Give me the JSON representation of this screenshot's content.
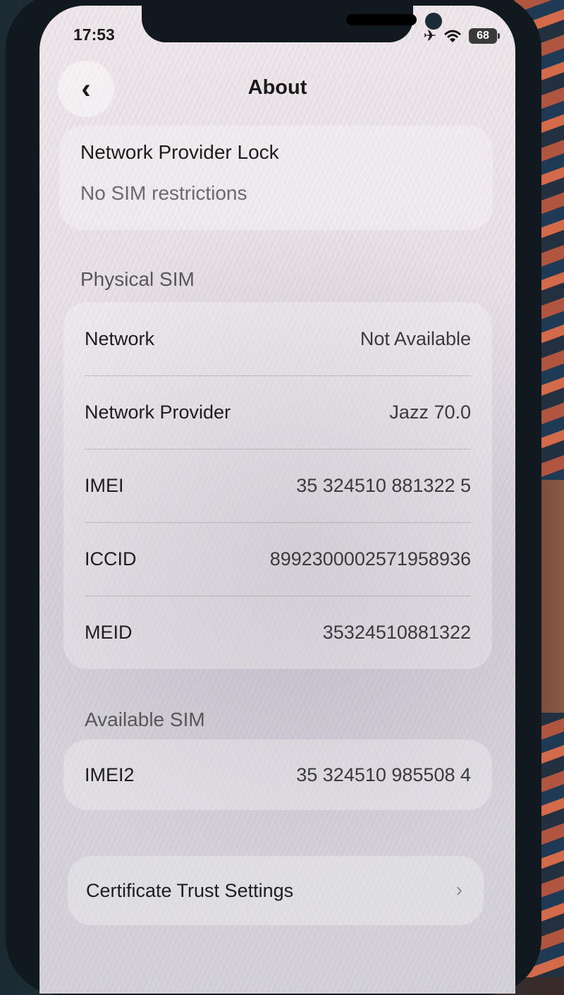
{
  "status_bar": {
    "time": "17:53",
    "battery": "68",
    "icons": [
      "airplane-icon",
      "wifi-icon",
      "battery-icon"
    ]
  },
  "nav": {
    "title": "About",
    "back_icon": "chevron-left-icon"
  },
  "lock": {
    "title": "Network Provider Lock",
    "value": "No SIM restrictions"
  },
  "physical_sim": {
    "header": "Physical SIM",
    "rows": [
      {
        "label": "Network",
        "value": "Not Available"
      },
      {
        "label": "Network Provider",
        "value": "Jazz 70.0"
      },
      {
        "label": "IMEI",
        "value": "35 324510 881322 5"
      },
      {
        "label": "ICCID",
        "value": "8992300002571958936"
      },
      {
        "label": "MEID",
        "value": "35324510881322"
      }
    ]
  },
  "available_sim": {
    "header": "Available SIM",
    "rows": [
      {
        "label": "IMEI2",
        "value": "35 324510 985508 4"
      }
    ]
  },
  "certificate": {
    "label": "Certificate Trust Settings",
    "chevron": "›"
  },
  "colors": {
    "screen_bg": "#e6e0e6",
    "text_primary": "#1d1d1d",
    "text_secondary": "#6a6a6a"
  }
}
